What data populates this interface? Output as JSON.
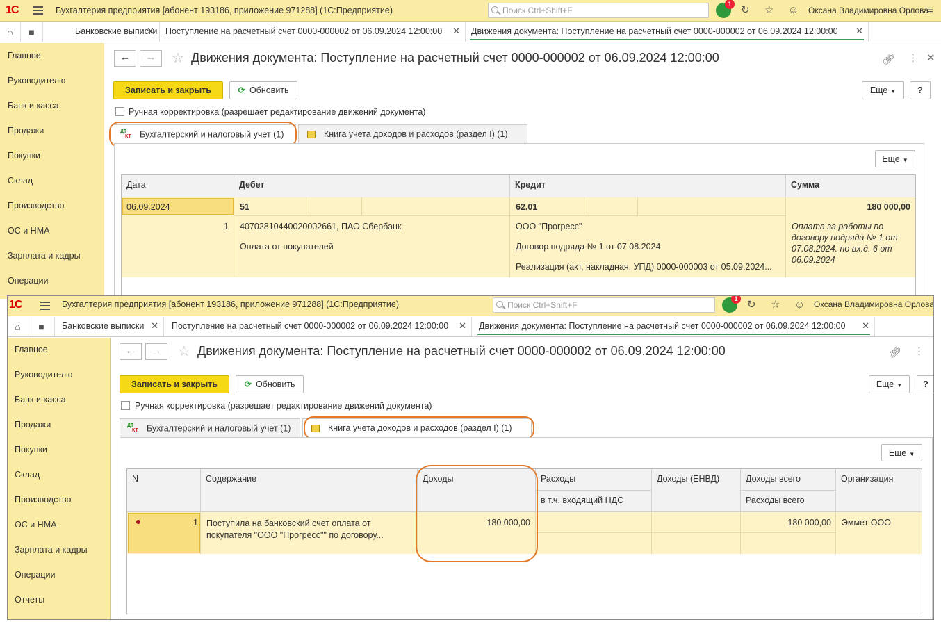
{
  "w1": {
    "app_title": "Бухгалтерия предприятия [абонент 193186, приложение 971288]  (1С:Предприятие)",
    "search_placeholder": "Поиск Ctrl+Shift+F",
    "notif_count": "1",
    "user": "Оксана Владимировна Орлова",
    "tabs": [
      "Банковские выписки",
      "Поступление на расчетный счет 0000-000002 от 06.09.2024 12:00:00",
      "Движения документа: Поступление на расчетный счет 0000-000002 от 06.09.2024 12:00:00"
    ],
    "sidebar": [
      "Главное",
      "Руководителю",
      "Банк и касса",
      "Продажи",
      "Покупки",
      "Склад",
      "Производство",
      "ОС и НМА",
      "Зарплата и кадры",
      "Операции"
    ],
    "doc_title": "Движения документа: Поступление на расчетный счет 0000-000002 от 06.09.2024 12:00:00",
    "save_close": "Записать и закрыть",
    "refresh": "Обновить",
    "more": "Еще",
    "help": "?",
    "manual_edit": "Ручная корректировка (разрешает редактирование движений документа)",
    "form_tabs": [
      "Бухгалтерский и налоговый учет (1)",
      "Книга учета доходов и расходов (раздел I) (1)"
    ],
    "grid_more": "Еще",
    "columns": [
      "Дата",
      "Дебет",
      "Кредит",
      "Сумма"
    ],
    "row": {
      "date": "06.09.2024",
      "num": "1",
      "debit_account": "51",
      "debit_sub1": "40702810440020002661, ПАО Сбербанк",
      "debit_sub2": "Оплата от покупателей",
      "credit_account": "62.01",
      "credit_sub1": "ООО \"Прогресс\"",
      "credit_sub2": "Договор подряда № 1 от 07.08.2024",
      "credit_sub3": "Реализация (акт, накладная, УПД) 0000-000003 от 05.09.2024...",
      "amount": "180 000,00",
      "comment": "Оплата за работы по договору подряда № 1 от 07.08.2024. по вх.д. 6 от 06.09.2024"
    }
  },
  "w2": {
    "app_title": "Бухгалтерия предприятия [абонент 193186, приложение 971288]  (1С:Предприятие)",
    "search_placeholder": "Поиск Ctrl+Shift+F",
    "notif_count": "1",
    "user": "Оксана Владимировна Орлова",
    "tabs": [
      "Банковские выписки",
      "Поступление на расчетный счет 0000-000002 от 06.09.2024 12:00:00",
      "Движения документа: Поступление на расчетный счет 0000-000002 от 06.09.2024 12:00:00"
    ],
    "sidebar": [
      "Главное",
      "Руководителю",
      "Банк и касса",
      "Продажи",
      "Покупки",
      "Склад",
      "Производство",
      "ОС и НМА",
      "Зарплата и кадры",
      "Операции",
      "Отчеты"
    ],
    "doc_title": "Движения документа: Поступление на расчетный счет 0000-000002 от 06.09.2024 12:00:00",
    "save_close": "Записать и закрыть",
    "refresh": "Обновить",
    "more": "Еще",
    "help": "?",
    "manual_edit": "Ручная корректировка (разрешает редактирование движений документа)",
    "form_tabs": [
      "Бухгалтерский и налоговый учет (1)",
      "Книга учета доходов и расходов (раздел I) (1)"
    ],
    "grid_more": "Еще",
    "columns": {
      "n": "N",
      "content": "Содержание",
      "income": "Доходы",
      "expenses": "Расходы",
      "expenses_vat": "в т.ч. входящий НДС",
      "income_envd": "Доходы (ЕНВД)",
      "income_total": "Доходы всего",
      "expenses_total": "Расходы всего",
      "org": "Организация"
    },
    "row": {
      "n": "1",
      "content": "Поступила на банковский счет оплата от покупателя \"ООО \"Прогресс\"\" по договору...",
      "income": "180 000,00",
      "income_total": "180 000,00",
      "org": "Эммет ООО"
    }
  },
  "colors": {
    "accent_yellow": "#f5d816",
    "panel_yellow": "#fbeca5",
    "highlight_orange": "#e37a2a",
    "row_bg": "#fdf3c6"
  }
}
